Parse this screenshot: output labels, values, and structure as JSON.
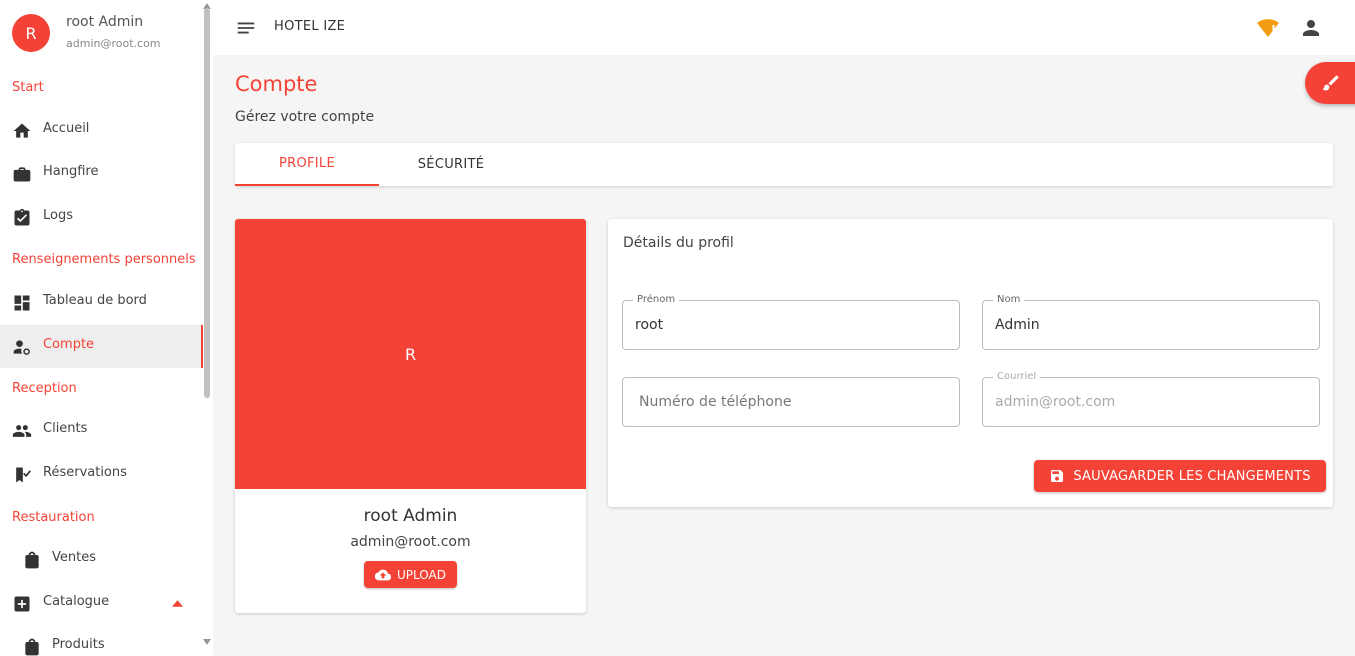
{
  "user": {
    "initial": "R",
    "name": "root Admin",
    "email": "admin@root.com"
  },
  "sidebar": {
    "sections": [
      "Start",
      "Renseignements personnels",
      "Reception",
      "Restauration"
    ],
    "items": [
      {
        "label": "Accueil",
        "icon": "home-icon"
      },
      {
        "label": "Hangfire",
        "icon": "briefcase-icon"
      },
      {
        "label": "Logs",
        "icon": "clipboard-check-icon"
      },
      {
        "label": "Tableau de bord",
        "icon": "dashboard-icon"
      },
      {
        "label": "Compte",
        "icon": "manage-accounts-icon",
        "active": true
      },
      {
        "label": "Clients",
        "icon": "people-icon"
      },
      {
        "label": "Réservations",
        "icon": "bookmark-check-icon"
      },
      {
        "label": "Ventes",
        "icon": "shopping-bag-icon"
      },
      {
        "label": "Catalogue",
        "icon": "add-box-icon",
        "expanded": true
      },
      {
        "label": "Produits",
        "icon": "shopping-bag-icon"
      }
    ]
  },
  "topbar": {
    "title": "HOTEL IZE"
  },
  "page": {
    "title": "Compte",
    "subtitle": "Gérez votre compte"
  },
  "tabs": [
    {
      "label": "PROFILE",
      "active": true
    },
    {
      "label": "SÉCURITÉ"
    }
  ],
  "profile_card": {
    "initial": "R",
    "name": "root Admin",
    "email": "admin@root.com",
    "upload_label": "UPLOAD"
  },
  "details": {
    "title": "Détails du profil",
    "fields": {
      "prenom": {
        "label": "Prénom",
        "value": "root"
      },
      "nom": {
        "label": "Nom",
        "value": "Admin"
      },
      "phone": {
        "placeholder": "Numéro de téléphone"
      },
      "courriel": {
        "label": "Courriel",
        "value": "admin@root.com"
      }
    },
    "save_label": "SAUVAGARDER LES CHANGEMENTS"
  },
  "colors": {
    "accent": "#f44336",
    "warning": "#f39c12"
  }
}
